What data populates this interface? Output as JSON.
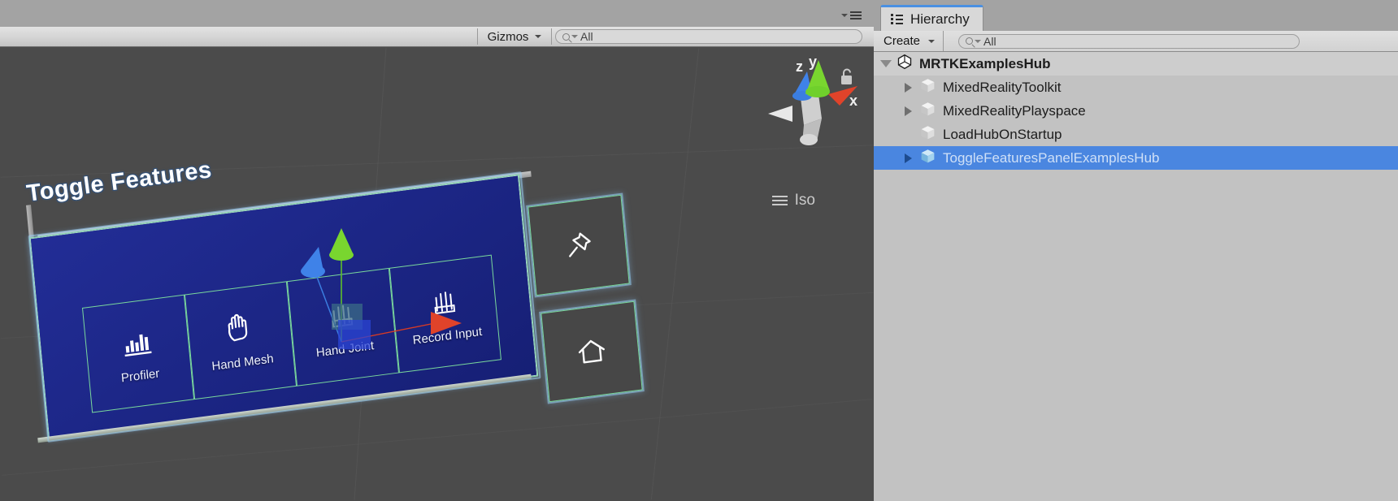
{
  "scene_view": {
    "tab_menu_icon": "panel-options-icon",
    "toolbar": {
      "gizmos_label": "Gizmos",
      "gizmos_caret_icon": "chevron-down-icon",
      "search_icon": "search-icon",
      "search_value": "All",
      "search_placeholder": "All"
    },
    "lock_icon": "lock-open-icon",
    "orientation_gizmo": {
      "axis_x_label": "x",
      "axis_y_label": "y",
      "axis_z_label": "z",
      "axis_x_color": "#e0432a",
      "axis_y_color": "#6fd02c",
      "axis_z_color": "#3b7ee0"
    },
    "projection_label": "Iso",
    "projection_menu_icon": "hamburger-icon",
    "background_color": "#4b4b4b",
    "selection_outline_color": "#7ad89c"
  },
  "hub": {
    "title": "Toggle Features",
    "panel_color": "#1b2486",
    "buttons": [
      {
        "label": "Profiler",
        "icon": "bar-chart-icon"
      },
      {
        "label": "Hand Mesh",
        "icon": "hand-mesh-icon"
      },
      {
        "label": "Hand Joint",
        "icon": "hand-joint-icon"
      },
      {
        "label": "Record Input",
        "icon": "hand-record-icon"
      }
    ],
    "side_buttons": [
      {
        "name": "pin-button",
        "icon": "pin-icon"
      },
      {
        "name": "home-button",
        "icon": "home-icon"
      }
    ]
  },
  "hierarchy": {
    "tab_label": "Hierarchy",
    "tab_icon": "hierarchy-icon",
    "tab_accent_color": "#4a90e2",
    "create_label": "Create",
    "create_caret_icon": "chevron-down-icon",
    "search_icon": "search-icon",
    "search_value": "All",
    "search_placeholder": "All",
    "selection_color": "#4a86e0",
    "items": [
      {
        "label": "MRTKExamplesHub",
        "depth": 0,
        "twisty": "open",
        "icon": "unity-scene-icon",
        "selected": false,
        "is_scene": true
      },
      {
        "label": "MixedRealityToolkit",
        "depth": 1,
        "twisty": "closed",
        "icon": "gameobject-icon",
        "selected": false,
        "is_scene": false
      },
      {
        "label": "MixedRealityPlayspace",
        "depth": 1,
        "twisty": "closed",
        "icon": "gameobject-icon",
        "selected": false,
        "is_scene": false
      },
      {
        "label": "LoadHubOnStartup",
        "depth": 1,
        "twisty": "none",
        "icon": "gameobject-icon",
        "selected": false,
        "is_scene": false
      },
      {
        "label": "ToggleFeaturesPanelExamplesHub",
        "depth": 1,
        "twisty": "closed",
        "icon": "prefab-icon",
        "selected": true,
        "is_scene": false
      }
    ]
  }
}
